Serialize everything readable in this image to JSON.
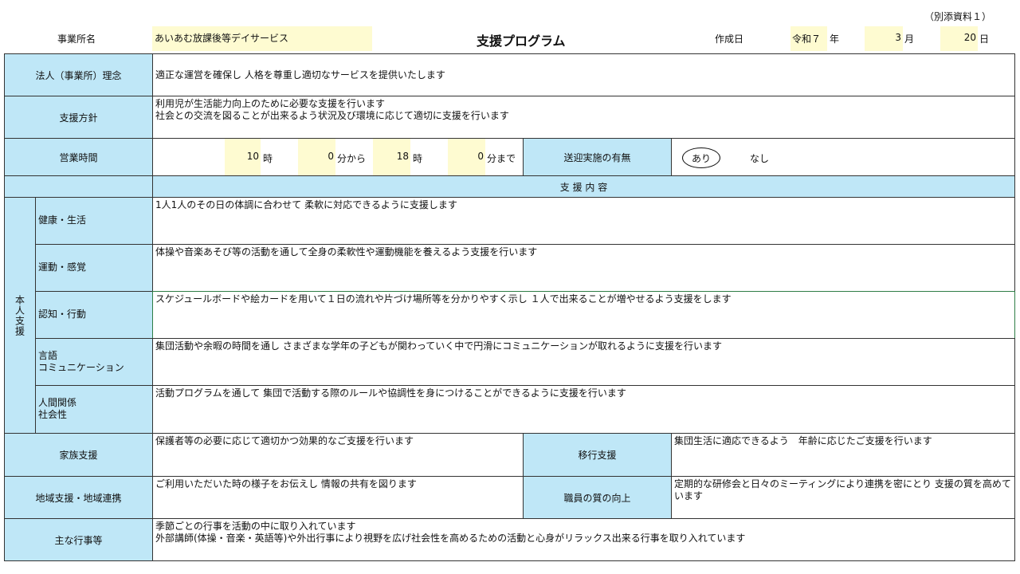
{
  "header": {
    "attachment": "（別添資料１）",
    "office_label": "事業所名",
    "office_name": "あいあむ放課後等デイサービス",
    "title": "支援プログラム",
    "date_label": "作成日",
    "era_year": "令和７",
    "year_suffix": "年",
    "month": "3",
    "month_suffix": "月",
    "day": "20",
    "day_suffix": "日"
  },
  "philosophy": {
    "label": "法人（事業所）理念",
    "text": "適正な運営を確保し 人格を尊重し適切なサービスを提供いたします"
  },
  "policy": {
    "label": "支援方針",
    "text": "利用児が生活能力向上のために必要な支援を行います\n社会との交流を図ることが出来るよう状況及び環境に応じて適切に支援を行います"
  },
  "hours": {
    "label": "営業時間",
    "start_hour": "10",
    "hour_unit": "時",
    "start_min": "0",
    "from_unit": "分から",
    "end_hour": "18",
    "end_min": "0",
    "until_unit": "分まで",
    "transport_label": "送迎実施の有無",
    "option_yes": "あり",
    "option_no": "なし"
  },
  "support_content_header": "支 援 内 容",
  "personal_support": {
    "label": "本人支援",
    "rows": [
      {
        "label": "健康・生活",
        "text": "1人1人のその日の体調に合わせて 柔軟に対応できるように支援します"
      },
      {
        "label": "運動・感覚",
        "text": "体操や音楽あそび等の活動を通して全身の柔軟性や運動機能を養えるよう支援を行います"
      },
      {
        "label": "認知・行動",
        "text": "スケジュールボードや絵カードを用いて１日の流れや片づけ場所等を分かりやすく示し １人で出来ることが増やせるよう支援をします"
      },
      {
        "label": "言語\nコミュニケーション",
        "text": "集団活動や余暇の時間を通し さまざまな学年の子どもが関わっていく中で円滑にコミュニケーションが取れるように支援を行います"
      },
      {
        "label": "人間関係\n社会性",
        "text": "活動プログラムを通して 集団で活動する際のルールや協調性を身につけることができるように支援を行います"
      }
    ]
  },
  "family": {
    "label": "家族支援",
    "text": "保護者等の必要に応じて適切かつ効果的なご支援を行います"
  },
  "transition": {
    "label": "移行支援",
    "text": "集団生活に適応できるよう　年齢に応じたご支援を行います"
  },
  "community": {
    "label": "地域支援・地域連携",
    "text": "ご利用いただいた時の様子をお伝えし 情報の共有を図ります"
  },
  "staff_quality": {
    "label": "職員の質の向上",
    "text": "定期的な研修会と日々のミーティングにより連携を密にとり 支援の質を高めています"
  },
  "events": {
    "label": "主な行事等",
    "text": "季節ごとの行事を活動の中に取り入れています\n外部講師(体操・音楽・英語等)や外出行事により視野を広げ社会性を高めるための活動と心身がリラックス出来る行事を取り入れています"
  }
}
